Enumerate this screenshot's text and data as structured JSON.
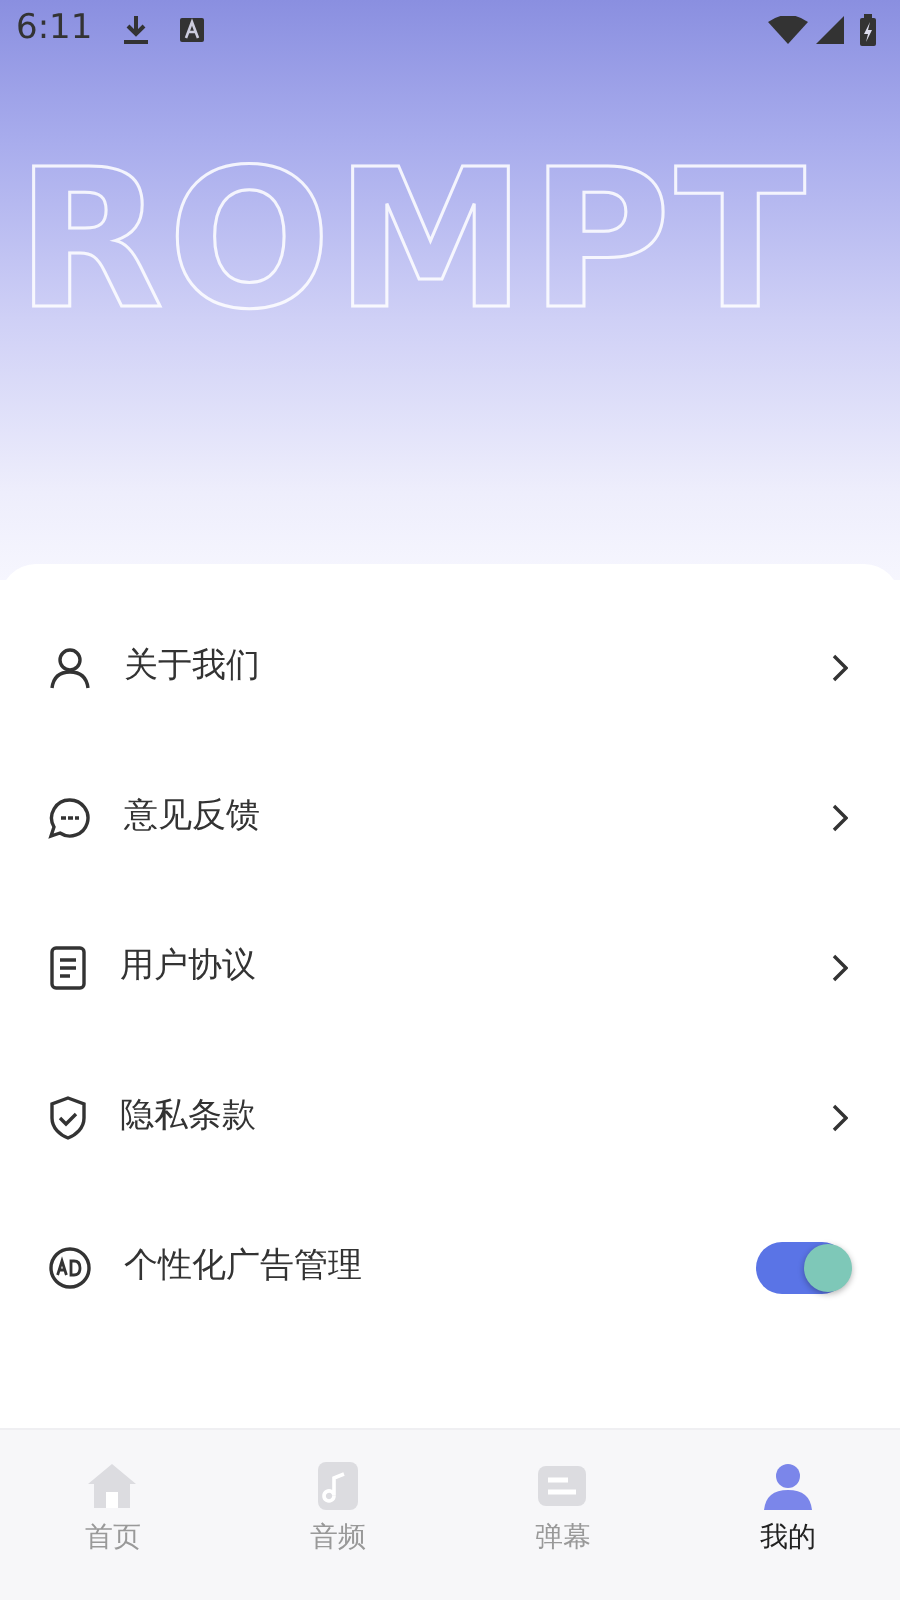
{
  "status_bar": {
    "time": "6:11"
  },
  "background_text": [
    "ROMPT"
  ],
  "menu": [
    {
      "kind": "link",
      "label": "关于我们"
    },
    {
      "kind": "link",
      "label": "意见反馈"
    },
    {
      "kind": "link",
      "label": "用户协议"
    },
    {
      "kind": "link",
      "label": "隐私条款"
    },
    {
      "kind": "toggle",
      "label": "个性化广告管理",
      "on": true
    }
  ],
  "tabs": [
    {
      "label": "首页",
      "selected": false
    },
    {
      "label": "音频",
      "selected": false
    },
    {
      "label": "弹幕",
      "selected": false
    },
    {
      "label": "我的",
      "selected": true
    }
  ]
}
